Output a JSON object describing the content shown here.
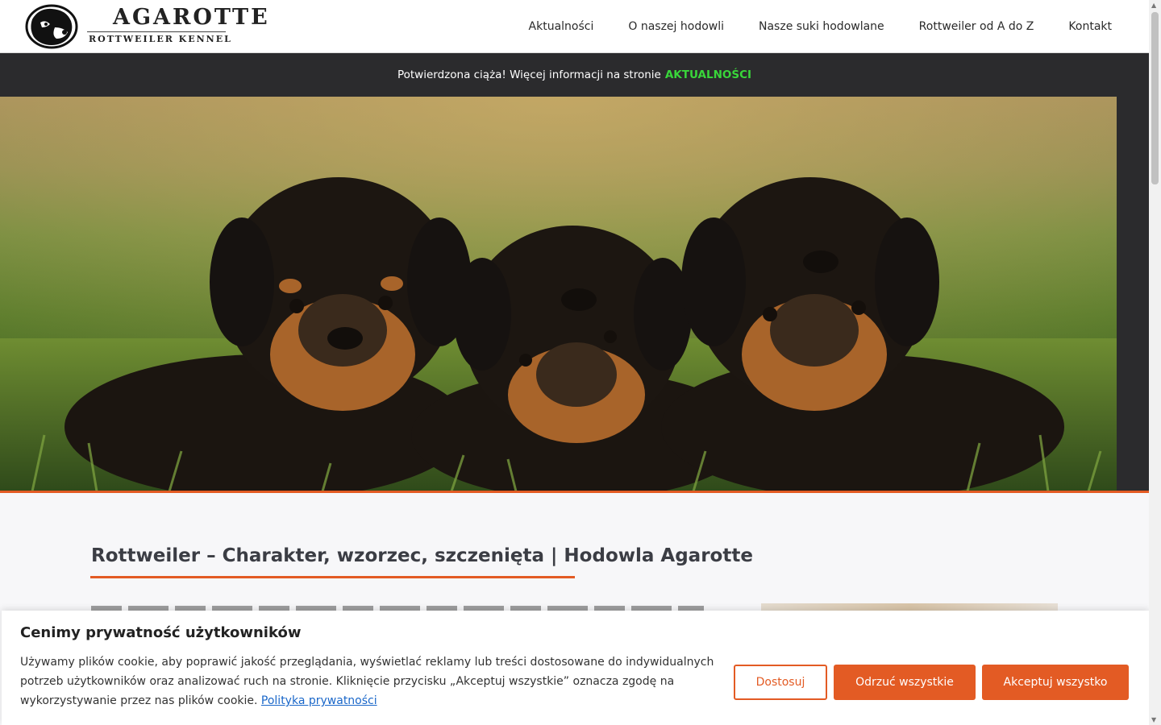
{
  "brand": {
    "title": "AGAROTTE",
    "subtitle": "ROTTWEILER KENNEL"
  },
  "nav": {
    "items": [
      {
        "label": "Aktualności"
      },
      {
        "label": "O naszej hodowli"
      },
      {
        "label": "Nasze suki hodowlane"
      },
      {
        "label": "Rottweiler od A do Z"
      },
      {
        "label": "Kontakt"
      }
    ]
  },
  "announcement": {
    "text": "Potwierdzona ciąża! Więcej informacji na stronie",
    "link": "AKTUALNOŚCI",
    "link_color": "#39d63a"
  },
  "main": {
    "title": "Rottweiler – Charakter, wzorzec, szczenięta | Hodowla Agarotte"
  },
  "cookie": {
    "heading": "Cenimy prywatność użytkowników",
    "body": "Używamy plików cookie, aby poprawić jakość przeglądania, wyświetlać reklamy lub treści dostosowane do indywidualnych potrzeb użytkowników oraz analizować ruch na stronie. Kliknięcie przycisku „Akceptuj wszystkie” oznacza zgodę na wykorzystywanie przez nas plików cookie.",
    "policy_link": "Polityka prywatności",
    "btn_customize": "Dostosuj",
    "btn_reject": "Odrzuć wszystkie",
    "btn_accept": "Akceptuj wszystko",
    "accent_color": "#e35b24"
  }
}
